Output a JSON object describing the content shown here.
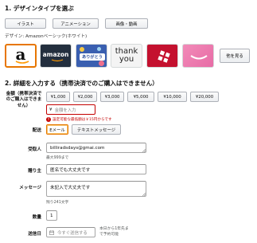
{
  "section1": {
    "title": "1. デザインタイプを選ぶ",
    "type_buttons": [
      "イラスト",
      "アニメーション",
      "画像・動画"
    ],
    "design_label": "デザイン: Amazonベーシック(ホワイト)",
    "cards": [
      {
        "name": "amazon-logo-white",
        "text": "a"
      },
      {
        "name": "amazon-logo-black",
        "text": "amazon"
      },
      {
        "name": "arigatou",
        "text": "ありがとう"
      },
      {
        "name": "thank-you",
        "text": "thank you"
      },
      {
        "name": "gift-box",
        "text": ""
      },
      {
        "name": "pink-smile",
        "text": ""
      }
    ],
    "see_more": "他を見る"
  },
  "section2": {
    "title": "2. 詳細を入力する（携帯決済でのご購入はできません）",
    "amount": {
      "label": "金額（携帯決済でのご購入はできません）",
      "presets": [
        "¥1,000",
        "¥2,000",
        "¥3,000",
        "¥5,000",
        "¥10,000",
        "¥20,000"
      ],
      "currency": "¥",
      "placeholder": "金額を入力",
      "error": "設定可能な最低額は￥15円からです"
    },
    "delivery": {
      "label": "配送",
      "options": [
        "Eメール",
        "テキストメッセージ"
      ]
    },
    "recipient": {
      "label": "受取人",
      "value": "billiradsdays@gmai.com",
      "hint": "最大999まで"
    },
    "sender": {
      "label": "贈り主",
      "value": "匿名でも大丈夫です"
    },
    "message": {
      "label": "メッセージ",
      "value": "未記入で大丈夫です",
      "hint": "残り241文字"
    },
    "quantity": {
      "label": "数量",
      "value": "1"
    },
    "send_date": {
      "label": "送信日",
      "placeholder": "今すぐ送信する",
      "note_line1": "本日から1年先ま",
      "note_line2": "で予約可能"
    }
  },
  "colors": {
    "accent": "#e77600",
    "error": "#c40000",
    "amazon_orange": "#ff9900"
  }
}
